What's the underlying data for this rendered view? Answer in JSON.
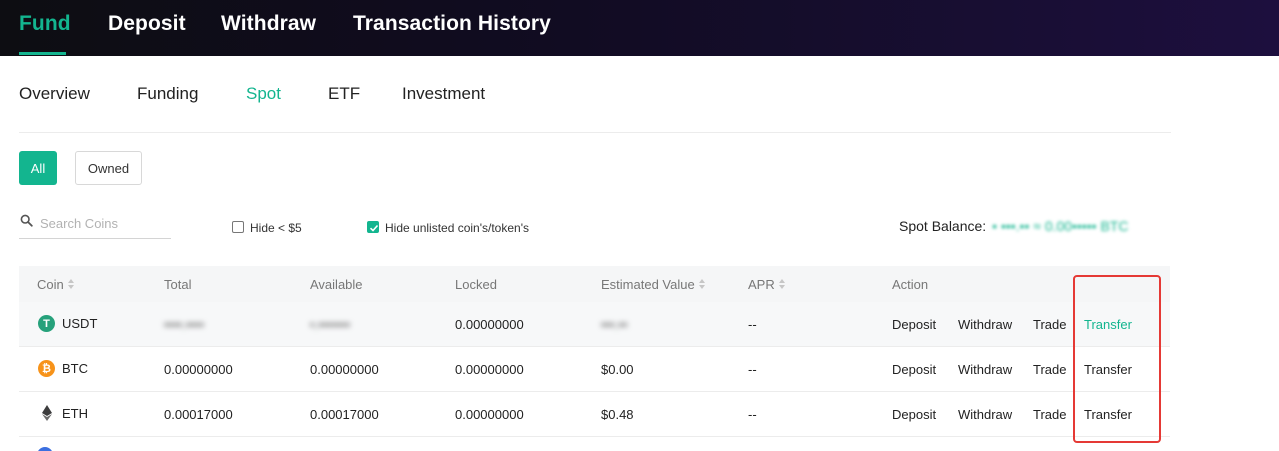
{
  "topnav": {
    "tabs": [
      {
        "label": "Fund",
        "active": true
      },
      {
        "label": "Deposit",
        "active": false
      },
      {
        "label": "Withdraw",
        "active": false
      },
      {
        "label": "Transaction History",
        "active": false
      }
    ]
  },
  "subnav": {
    "tabs": [
      {
        "label": "Overview",
        "active": false
      },
      {
        "label": "Funding",
        "active": false
      },
      {
        "label": "Spot",
        "active": true
      },
      {
        "label": "ETF",
        "active": false
      },
      {
        "label": "Investment",
        "active": false
      }
    ]
  },
  "filters": {
    "all_label": "All",
    "owned_label": "Owned",
    "selected": "All"
  },
  "search": {
    "placeholder": "Search Coins",
    "icon": "search-icon"
  },
  "options": {
    "hide_small": {
      "label": "Hide < $5",
      "checked": false
    },
    "hide_unlisted": {
      "label": "Hide unlisted coin's/token's",
      "checked": true
    }
  },
  "balance": {
    "label": "Spot Balance:",
    "value": "• •••.•• ≈ 0.00••••• BTC"
  },
  "table": {
    "headers": {
      "coin": "Coin",
      "total": "Total",
      "available": "Available",
      "locked": "Locked",
      "estimated_value": "Estimated Value",
      "apr": "APR",
      "action": "Action"
    },
    "rows": [
      {
        "coin": "USDT",
        "icon": "tether-icon",
        "icon_color": "#26a17b",
        "total": "••••.••••",
        "available": "•.•••••••",
        "locked": "0.00000000",
        "estimated_value": "•••.••",
        "apr": "--",
        "actions": [
          "Deposit",
          "Withdraw",
          "Trade",
          "Transfer"
        ]
      },
      {
        "coin": "BTC",
        "icon": "bitcoin-icon",
        "icon_color": "#f7931a",
        "total": "0.00000000",
        "available": "0.00000000",
        "locked": "0.00000000",
        "estimated_value": "$0.00",
        "apr": "--",
        "actions": [
          "Deposit",
          "Withdraw",
          "Trade",
          "Transfer"
        ]
      },
      {
        "coin": "ETH",
        "icon": "ethereum-icon",
        "icon_color": "#3c3c3d",
        "total": "0.00017000",
        "available": "0.00017000",
        "locked": "0.00000000",
        "estimated_value": "$0.48",
        "apr": "--",
        "actions": [
          "Deposit",
          "Withdraw",
          "Trade",
          "Transfer"
        ]
      }
    ]
  },
  "colors": {
    "accent": "#13b58f",
    "highlight": "#e53935",
    "topbar": "#110c22"
  }
}
